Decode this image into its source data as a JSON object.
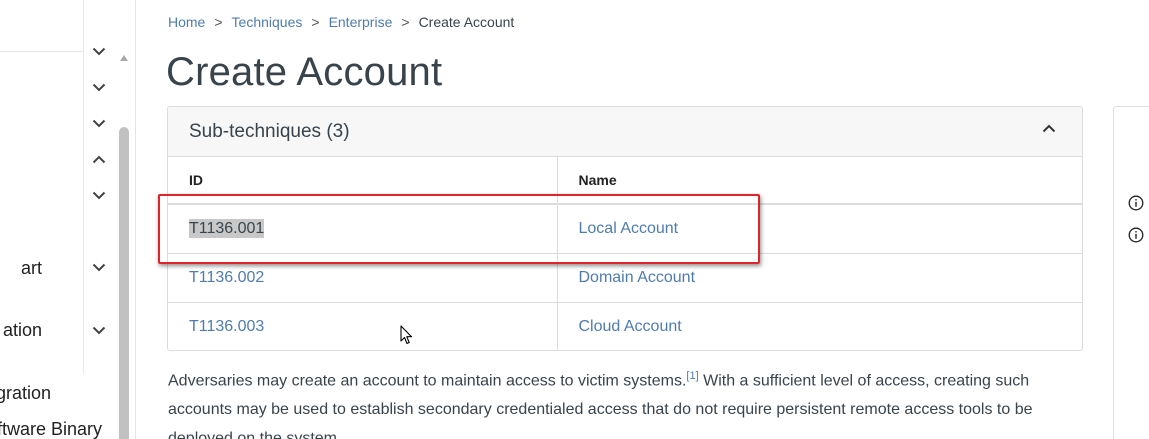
{
  "sidebar": {
    "items": [
      {
        "label": "art"
      },
      {
        "label": "ation"
      },
      {
        "label": "gration"
      },
      {
        "label": "ftware Binary"
      }
    ]
  },
  "breadcrumb": {
    "items": [
      "Home",
      "Techniques",
      "Enterprise"
    ],
    "separator": ">",
    "current": "Create Account"
  },
  "page": {
    "title": "Create Account"
  },
  "subtechniques": {
    "header": "Sub-techniques (3)",
    "columns": [
      "ID",
      "Name"
    ],
    "rows": [
      {
        "id": "T1136.001",
        "name": "Local Account"
      },
      {
        "id": "T1136.002",
        "name": "Domain Account"
      },
      {
        "id": "T1136.003",
        "name": "Cloud Account"
      }
    ]
  },
  "description": {
    "part1": "Adversaries may create an account to maintain access to victim systems.",
    "citation": "[1]",
    "part2": " With a sufficient level of access, creating such accounts may be used to establish secondary credentialed access that do not require persistent remote access tools to be deployed on the system."
  },
  "colors": {
    "link": "#4f7cac",
    "text": "#39434c",
    "highlight_box": "#e1242b",
    "selection": "#c8c8c8"
  },
  "icons": {
    "expand": "chevron-down-icon",
    "collapse": "chevron-up-icon",
    "info": "info-icon"
  }
}
